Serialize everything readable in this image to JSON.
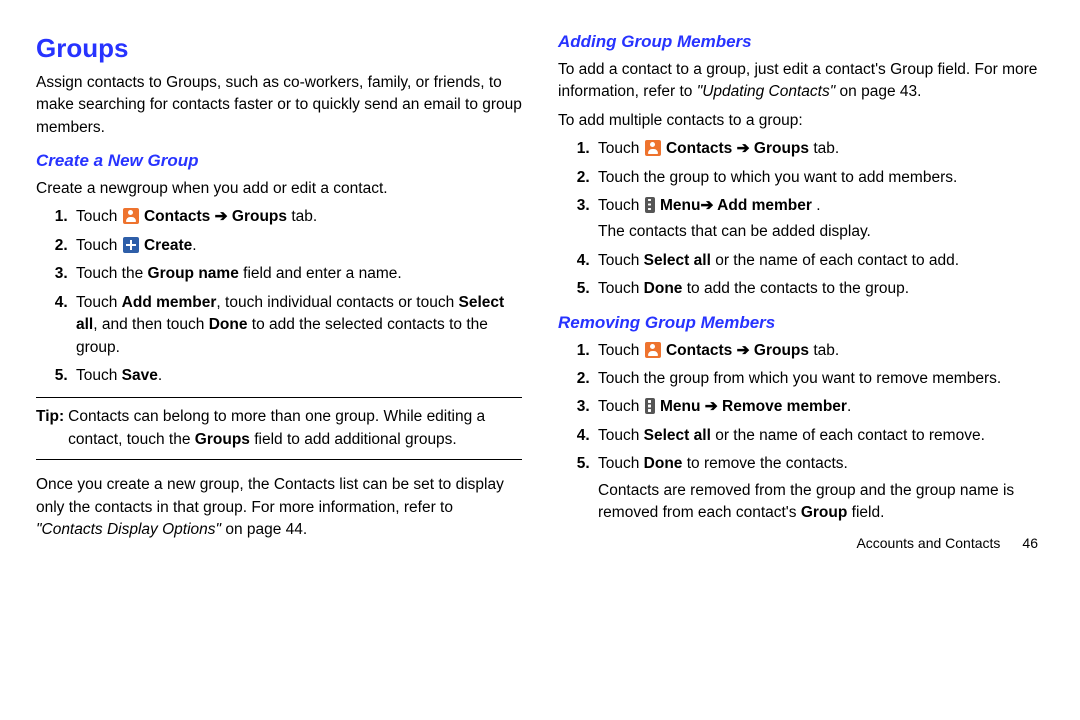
{
  "left": {
    "h1": "Groups",
    "intro": "Assign contacts to Groups, such as co-workers, family, or friends, to make searching for contacts faster or to quickly send an email to group members.",
    "h2_create": "Create a New Group",
    "create_intro": "Create a newgroup when you add or edit a contact.",
    "steps": {
      "s1_pre": "Touch ",
      "s1_bold": " Contacts ➔ Groups",
      "s1_post": " tab.",
      "s2_pre": "Touch ",
      "s2_bold": " Create",
      "s2_post": ".",
      "s3_pre": "Touch the ",
      "s3_bold": "Group name",
      "s3_post": " field and enter a name.",
      "s4_pre": "Touch ",
      "s4_b1": "Add member",
      "s4_mid1": ", touch individual contacts or touch ",
      "s4_b2": "Select all",
      "s4_mid2": ", and then touch ",
      "s4_b3": "Done",
      "s4_post": " to add the selected contacts to the group.",
      "s5_pre": "Touch ",
      "s5_bold": "Save",
      "s5_post": "."
    },
    "tip_label": "Tip:",
    "tip_body_1": "Contacts can belong to more than one group. While editing a contact, touch the ",
    "tip_bold": "Groups",
    "tip_body_2": " field to add additional groups.",
    "after_tip_1": "Once you create a new group, the Contacts list can be set to display only the contacts in that group. For more information, refer to ",
    "after_tip_italic": "\"Contacts Display Options\"",
    "after_tip_2": " on page 44."
  },
  "right": {
    "h2_add": "Adding Group Members",
    "add_p1_1": "To add a contact to a group, just edit a contact's Group field. For more information, refer to ",
    "add_p1_italic": "\"Updating Contacts\"",
    "add_p1_2": " on page 43.",
    "add_p2": "To add multiple contacts to a group:",
    "add_steps": {
      "s1_pre": "Touch ",
      "s1_bold": " Contacts ➔ Groups",
      "s1_post": " tab.",
      "s2": "Touch the group to which you want to add members.",
      "s3_pre": "Touch ",
      "s3_bold": " Menu➔ Add member",
      "s3_post": " .",
      "s3_sub": "The contacts that can be added display.",
      "s4_pre": "Touch ",
      "s4_bold": "Select all",
      "s4_post": " or the name of each contact to add.",
      "s5_pre": "Touch ",
      "s5_bold": "Done",
      "s5_post": " to add the contacts to the group."
    },
    "h2_remove": "Removing Group Members",
    "rm_steps": {
      "s1_pre": "Touch ",
      "s1_bold": " Contacts ➔ Groups",
      "s1_post": " tab.",
      "s2": "Touch the group from which you want to remove members.",
      "s3_pre": "Touch ",
      "s3_bold": " Menu ➔ Remove member",
      "s3_post": ".",
      "s4_pre": "Touch ",
      "s4_bold": "Select all",
      "s4_post": " or the name of each contact to remove.",
      "s5_pre": "Touch ",
      "s5_bold": "Done",
      "s5_post": " to remove the contacts.",
      "s5_sub_1": "Contacts are removed from the group and the group name is removed from each contact's ",
      "s5_sub_bold": "Group",
      "s5_sub_2": " field."
    }
  },
  "footer": {
    "section": "Accounts and Contacts",
    "page": "46"
  }
}
